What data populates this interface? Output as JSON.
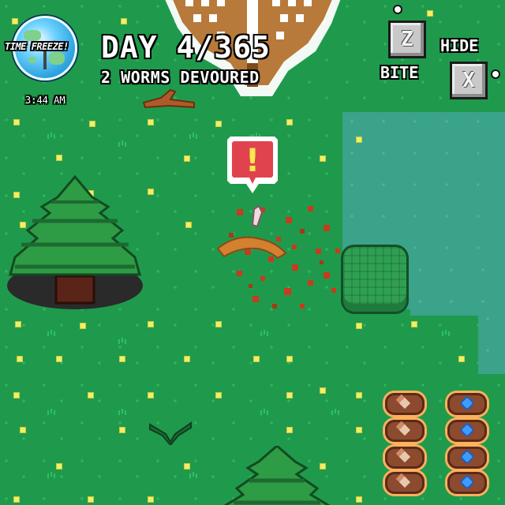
{
  "hud": {
    "day_text": "DAY 4/365",
    "worms_text": "2 WORMS DEVOURED",
    "time_freeze_label": "TIME FREEZE!",
    "clock_text": "3:44 AM"
  },
  "controls": {
    "bite_key": "Z",
    "bite_label": "BITE",
    "hide_label": "HIDE",
    "hide_key": "X"
  },
  "alert": {
    "symbol": "!"
  },
  "inventory": {
    "food_slots": 4,
    "water_slots": 4
  },
  "icons": {
    "globe": "time-freeze-globe-icon",
    "alert": "alert-bubble-icon",
    "food": "meat-icon",
    "water": "water-drop-icon"
  },
  "colors": {
    "grass": "#1f9a4c",
    "water": "#3aa38a",
    "alert_red": "#e0434e",
    "flower": "#f2ef63"
  }
}
